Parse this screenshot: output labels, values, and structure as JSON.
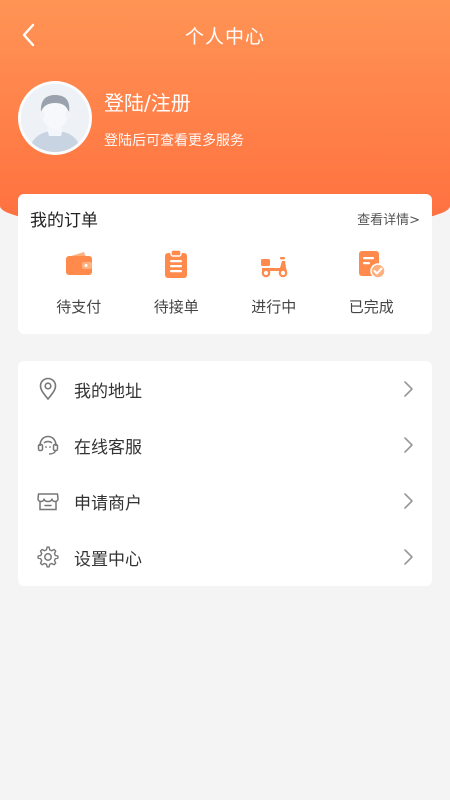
{
  "nav": {
    "title": "个人中心",
    "back_icon": "chevron-left-icon"
  },
  "profile": {
    "login_label": "登陆/注册",
    "subtitle": "登陆后可查看更多服务",
    "avatar_icon": "default-avatar-icon"
  },
  "orders": {
    "title": "我的订单",
    "more_label": "查看详情>",
    "items": [
      {
        "label": "待支付",
        "icon": "wallet-icon"
      },
      {
        "label": "待接单",
        "icon": "clipboard-icon"
      },
      {
        "label": "进行中",
        "icon": "scooter-icon"
      },
      {
        "label": "已完成",
        "icon": "document-check-icon"
      }
    ]
  },
  "menu": {
    "items": [
      {
        "label": "我的地址",
        "icon": "location-pin-icon"
      },
      {
        "label": "在线客服",
        "icon": "customer-service-icon"
      },
      {
        "label": "申请商户",
        "icon": "store-icon"
      },
      {
        "label": "设置中心",
        "icon": "gear-icon"
      }
    ]
  },
  "colors": {
    "header_top": "#ff9455",
    "header_bottom": "#ff6f3f",
    "icon_orange": "#ff8a4c",
    "background": "#f4f4f4",
    "card": "#ffffff"
  }
}
